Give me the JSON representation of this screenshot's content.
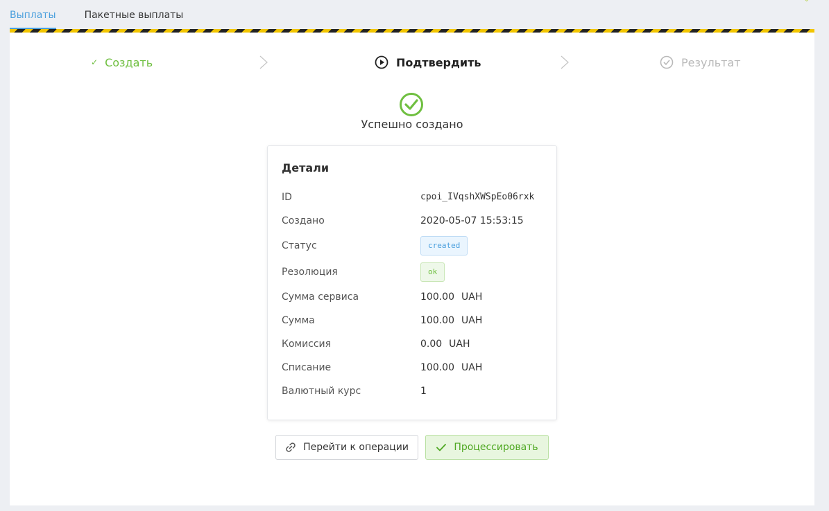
{
  "tabs": [
    {
      "label": "Выплаты",
      "active": true
    },
    {
      "label": "Пакетные выплаты",
      "active": false
    }
  ],
  "steps": {
    "create": "Создать",
    "confirm": "Подтвердить",
    "result": "Результат"
  },
  "status_message": "Успешно создано",
  "details": {
    "title": "Детали",
    "rows": [
      {
        "label": "ID",
        "value": "cpoi_IVqshXWSpEo06rxk"
      },
      {
        "label": "Создано",
        "value": "2020-05-07 15:53:15"
      },
      {
        "label": "Статус",
        "value": "created"
      },
      {
        "label": "Резолюция",
        "value": "ok"
      },
      {
        "label": "Сумма сервиса",
        "value": "100.00",
        "currency": "UAH"
      },
      {
        "label": "Сумма",
        "value": "100.00",
        "currency": "UAH"
      },
      {
        "label": "Комиссия",
        "value": "0.00",
        "currency": "UAH"
      },
      {
        "label": "Списание",
        "value": "100.00",
        "currency": "UAH"
      },
      {
        "label": "Валютный курс",
        "value": "1"
      }
    ]
  },
  "buttons": {
    "go_to_operation": "Перейти к операции",
    "process": "Процессировать"
  },
  "colors": {
    "accent_blue": "#4a9fdd",
    "success_green": "#6fbf40",
    "hazard_yellow": "#f2c500"
  },
  "icons": [
    "check-icon",
    "play-circle-icon",
    "check-circle-icon",
    "chevron-right-icon",
    "link-icon"
  ]
}
